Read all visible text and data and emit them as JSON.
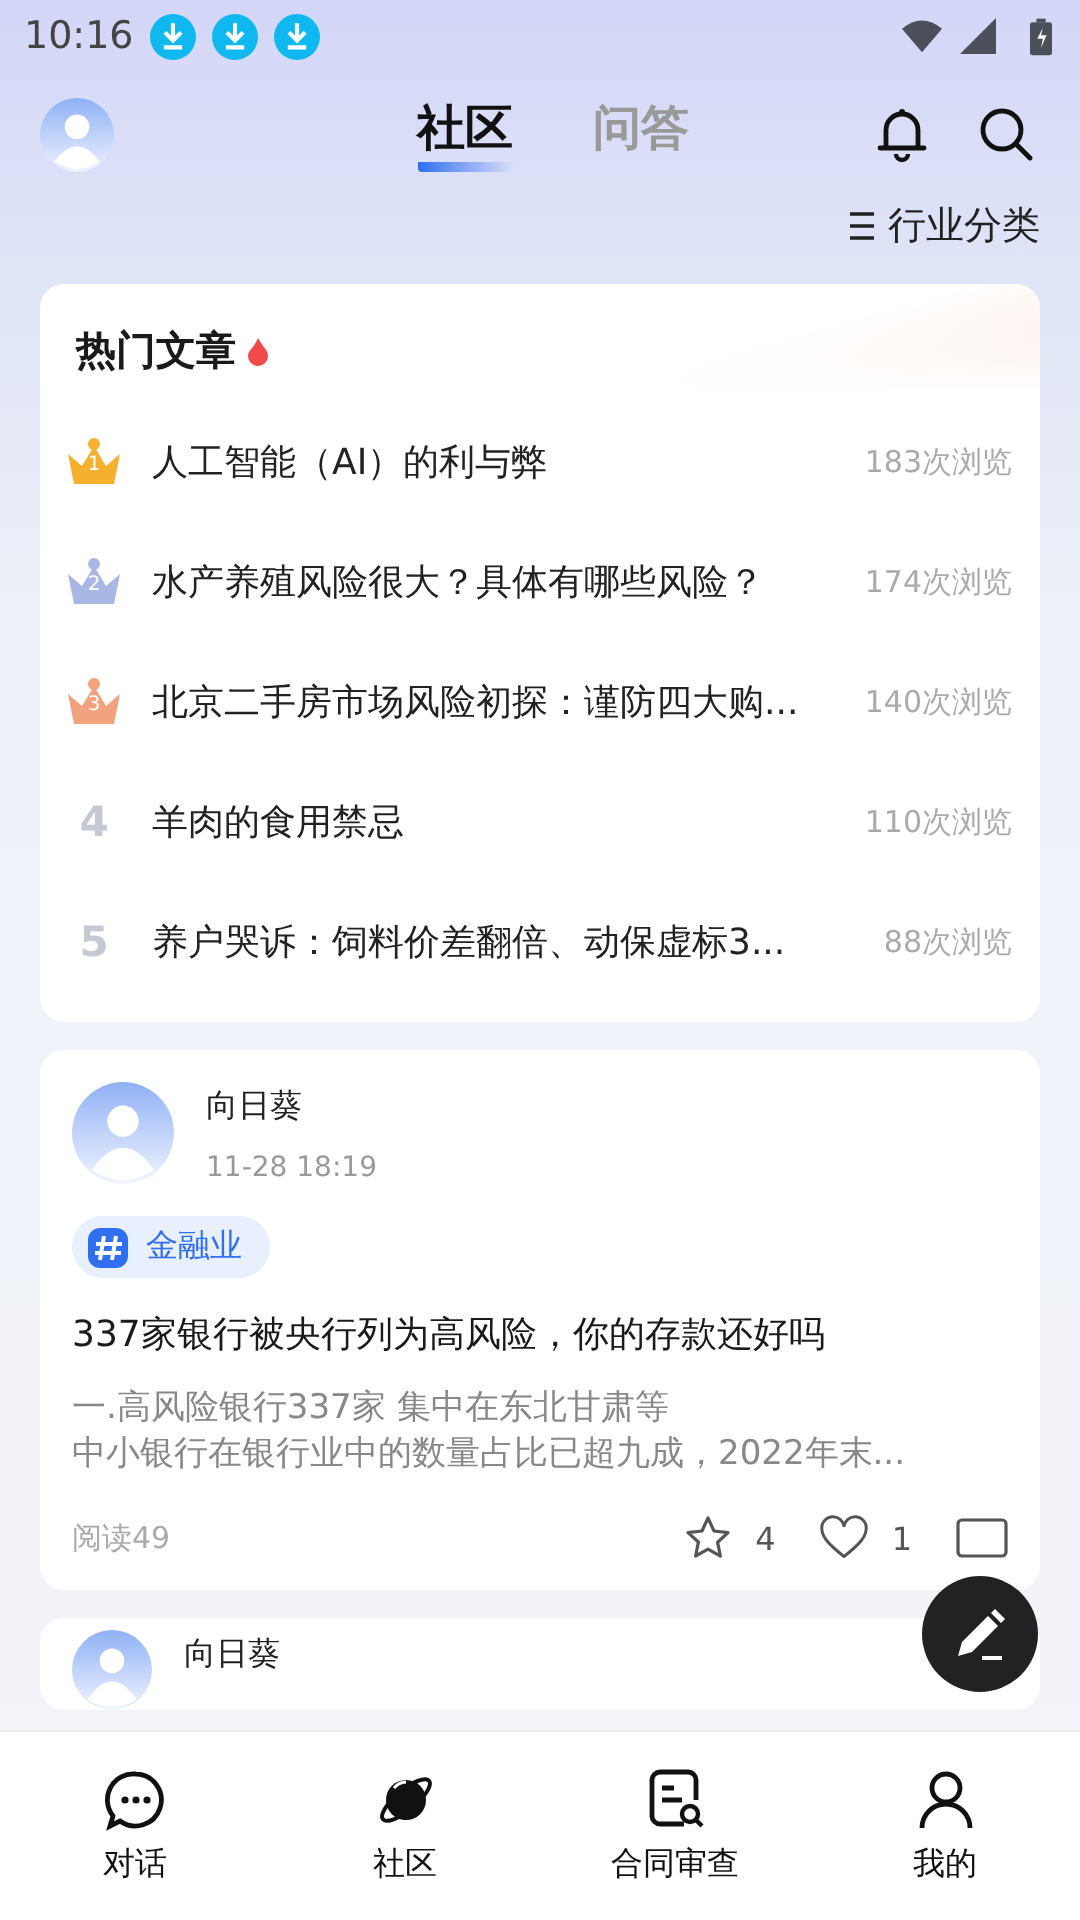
{
  "status_bar": {
    "time": "10:16"
  },
  "header": {
    "tabs": [
      {
        "label": "社区",
        "selected": true
      },
      {
        "label": "问答",
        "selected": false
      }
    ]
  },
  "category_filter": {
    "label": "行业分类"
  },
  "hot_articles": {
    "title": "热门文章",
    "items": [
      {
        "kind": "crown",
        "rank": "1",
        "color": "#f5b02e",
        "title": "人工智能（AI）的利与弊",
        "views": "183次浏览"
      },
      {
        "kind": "crown",
        "rank": "2",
        "color": "#a9b7e4",
        "title": "水产养殖风险很大？具体有哪些风险？",
        "views": "174次浏览"
      },
      {
        "kind": "crown",
        "rank": "3",
        "color": "#f2a27c",
        "title": "北京二手房市场风险初探：谨防四大购...",
        "views": "140次浏览"
      },
      {
        "kind": "number",
        "rank": "4",
        "title": "羊肉的食用禁忌",
        "views": "110次浏览"
      },
      {
        "kind": "number",
        "rank": "5",
        "title": "养户哭诉：饲料价差翻倍、动保虚标3...",
        "views": "88次浏览"
      }
    ]
  },
  "posts": [
    {
      "author": "向日葵",
      "time": "11-28 18:19",
      "tag": "金融业",
      "title": "337家银行被央行列为高风险，你的存款还好吗",
      "excerpt_lines": [
        "一.高风险银行337家 集中在东北甘肃等",
        "中小银行在银行业中的数量占比已超九成，2022年末..."
      ],
      "reads": "阅读49",
      "favorites": "4",
      "likes": "1"
    },
    {
      "author": "向日葵"
    }
  ],
  "bottom_nav": [
    {
      "kind": "chat",
      "label": "对话"
    },
    {
      "kind": "planet",
      "label": "社区"
    },
    {
      "kind": "contract",
      "label": "合同审查"
    },
    {
      "kind": "user",
      "label": "我的"
    }
  ]
}
